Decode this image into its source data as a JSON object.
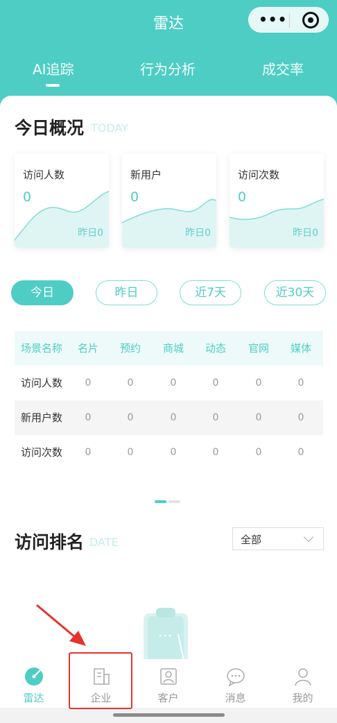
{
  "header": {
    "title": "雷达",
    "tabs": [
      {
        "label": "AI追踪",
        "active": true
      },
      {
        "label": "行为分析",
        "active": false
      },
      {
        "label": "成交率",
        "active": false
      }
    ]
  },
  "today": {
    "title": "今日概况",
    "subtitle": "TODAY",
    "stats": [
      {
        "label": "访问人数",
        "value": "0",
        "yesterday": "昨日0"
      },
      {
        "label": "新用户",
        "value": "0",
        "yesterday": "昨日0"
      },
      {
        "label": "访问次数",
        "value": "0",
        "yesterday": "昨日0"
      }
    ]
  },
  "filters": [
    {
      "label": "今日",
      "active": true
    },
    {
      "label": "昨日",
      "active": false
    },
    {
      "label": "近7天",
      "active": false
    },
    {
      "label": "近30天",
      "active": false
    }
  ],
  "table": {
    "headers": [
      "场景名称",
      "名片",
      "预约",
      "商城",
      "动态",
      "官网",
      "媒体"
    ],
    "rows": [
      {
        "name": "访问人数",
        "values": [
          "0",
          "0",
          "0",
          "0",
          "0",
          "0"
        ]
      },
      {
        "name": "新用户数",
        "values": [
          "0",
          "0",
          "0",
          "0",
          "0",
          "0"
        ]
      },
      {
        "name": "访问次数",
        "values": [
          "0",
          "0",
          "0",
          "0",
          "0",
          "0"
        ]
      }
    ]
  },
  "ranking": {
    "title": "访问排名",
    "subtitle": "DATE",
    "select_value": "全部"
  },
  "nav": [
    {
      "label": "雷达",
      "icon": "radar-icon",
      "active": true
    },
    {
      "label": "企业",
      "icon": "enterprise-icon",
      "active": false
    },
    {
      "label": "客户",
      "icon": "customer-icon",
      "active": false
    },
    {
      "label": "消息",
      "icon": "message-icon",
      "active": false
    },
    {
      "label": "我的",
      "icon": "profile-icon",
      "active": false
    }
  ],
  "colors": {
    "accent": "#4ecdc4",
    "annotation": "#e5322d"
  }
}
